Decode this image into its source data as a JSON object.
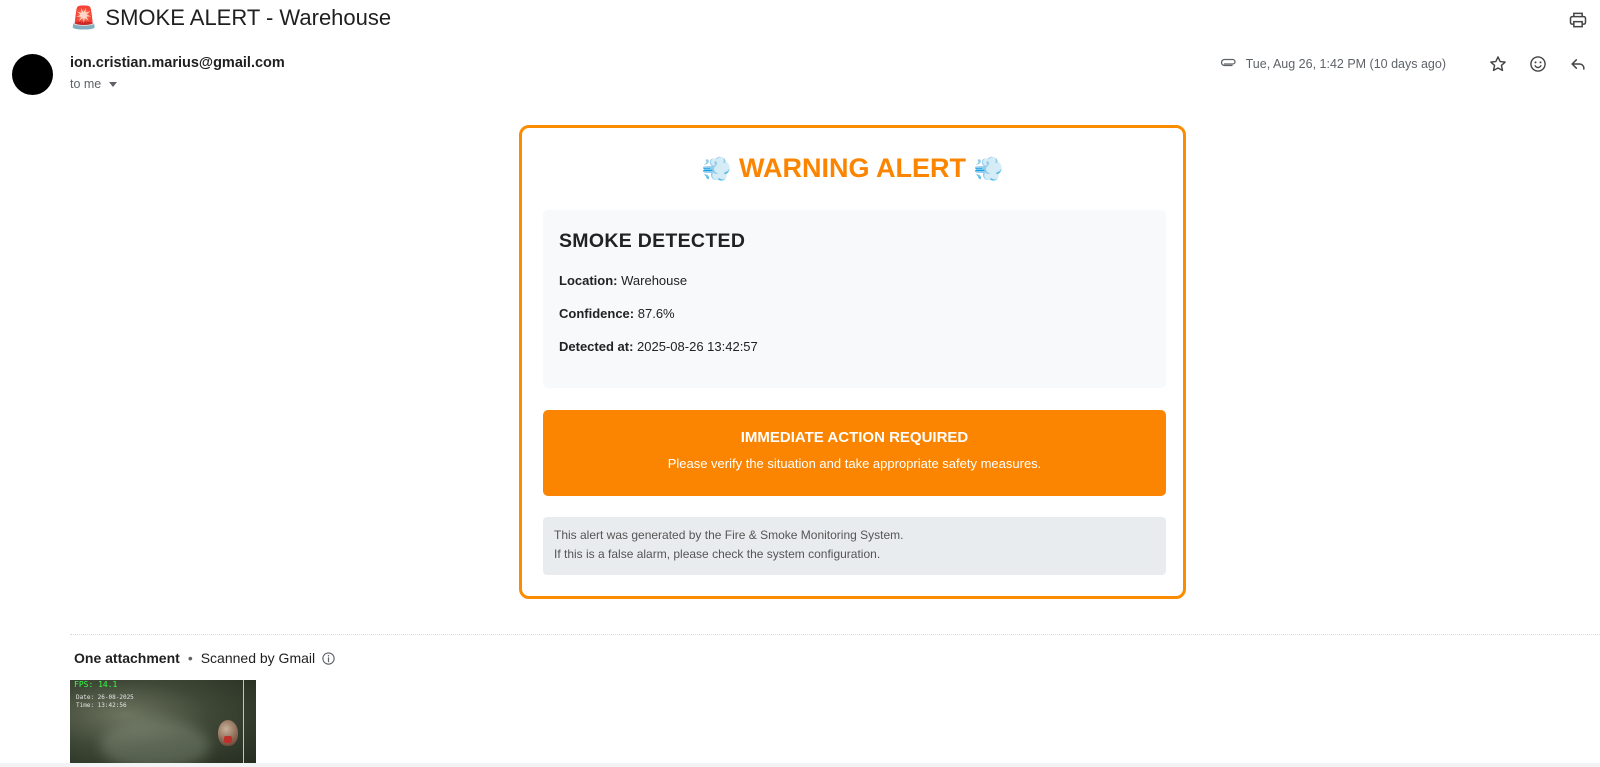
{
  "email": {
    "subject_emoji": "🚨",
    "subject": "SMOKE ALERT - Warehouse",
    "sender": "ion.cristian.marius@gmail.com",
    "recipient_label": "to me",
    "date": "Tue, Aug 26, 1:42 PM (10 days ago)"
  },
  "alert": {
    "title_emoji": "💨",
    "title": "WARNING ALERT",
    "heading": "SMOKE DETECTED",
    "location_label": "Location:",
    "location_value": "Warehouse",
    "confidence_label": "Confidence:",
    "confidence_value": "87.6%",
    "detected_label": "Detected at:",
    "detected_value": "2025-08-26 13:42:57",
    "action_title": "IMMEDIATE ACTION REQUIRED",
    "action_text": "Please verify the situation and take appropriate safety measures.",
    "footer_line1": "This alert was generated by the Fire & Smoke Monitoring System.",
    "footer_line2": "If this is a false alarm, please check the system configuration."
  },
  "attachments": {
    "count_label": "One attachment",
    "separator": "•",
    "scanned_label": "Scanned by Gmail",
    "thumbnail": {
      "fps_text": "FPS: 14.1",
      "date_text": "Date: 26-08-2025",
      "time_text": "Time: 13:42:56"
    }
  },
  "icons": [
    "print-icon",
    "paperclip-icon",
    "star-icon",
    "emoji-icon",
    "reply-icon",
    "info-icon",
    "chevron-down-icon"
  ],
  "colors": {
    "accent_orange": "#fb8500",
    "card_border": "#fb8c00",
    "info_bg": "#f8f9fa",
    "footer_bg": "#e9ecef"
  }
}
